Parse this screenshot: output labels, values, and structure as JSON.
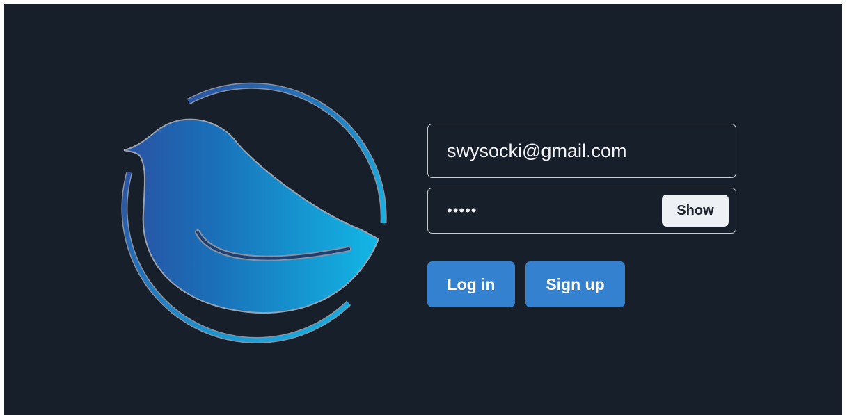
{
  "logo": {
    "icon": "bluebird-logo-icon"
  },
  "login_form": {
    "email": {
      "value": "swysocki@gmail.com",
      "placeholder": ""
    },
    "password": {
      "value": "•••••",
      "show_label": "Show"
    },
    "login_label": "Log in",
    "signup_label": "Sign up"
  },
  "colors": {
    "background": "#171f2a",
    "button_primary": "#3481cf",
    "show_button": "#edf0f4",
    "logo_gradient_start": "#2a52a3",
    "logo_gradient_end": "#12b7e6"
  }
}
